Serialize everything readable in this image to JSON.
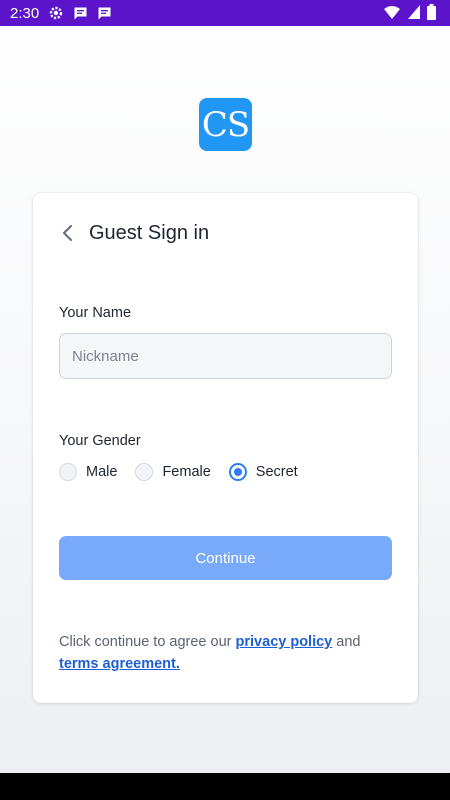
{
  "status_bar": {
    "time": "2:30",
    "left_icons": [
      "gear-icon",
      "message-icon",
      "message-icon"
    ],
    "right_icons": [
      "wifi-icon",
      "signal-icon",
      "battery-icon"
    ],
    "color": "#5b14c9"
  },
  "logo": {
    "text": "CS",
    "color": "#2196f3"
  },
  "header": {
    "title": "Guest Sign in"
  },
  "name": {
    "label": "Your Name",
    "placeholder": "Nickname",
    "value": ""
  },
  "gender": {
    "label": "Your Gender",
    "options": [
      {
        "label": "Male",
        "checked": false
      },
      {
        "label": "Female",
        "checked": false
      },
      {
        "label": "Secret",
        "checked": true
      }
    ]
  },
  "continue_button": {
    "label": "Continue",
    "color": "#78aaf9"
  },
  "agreement": {
    "prefix": "Click continue to agree our",
    "privacy_link": "privacy policy",
    "middle": "and",
    "terms_link": "terms agreement."
  }
}
